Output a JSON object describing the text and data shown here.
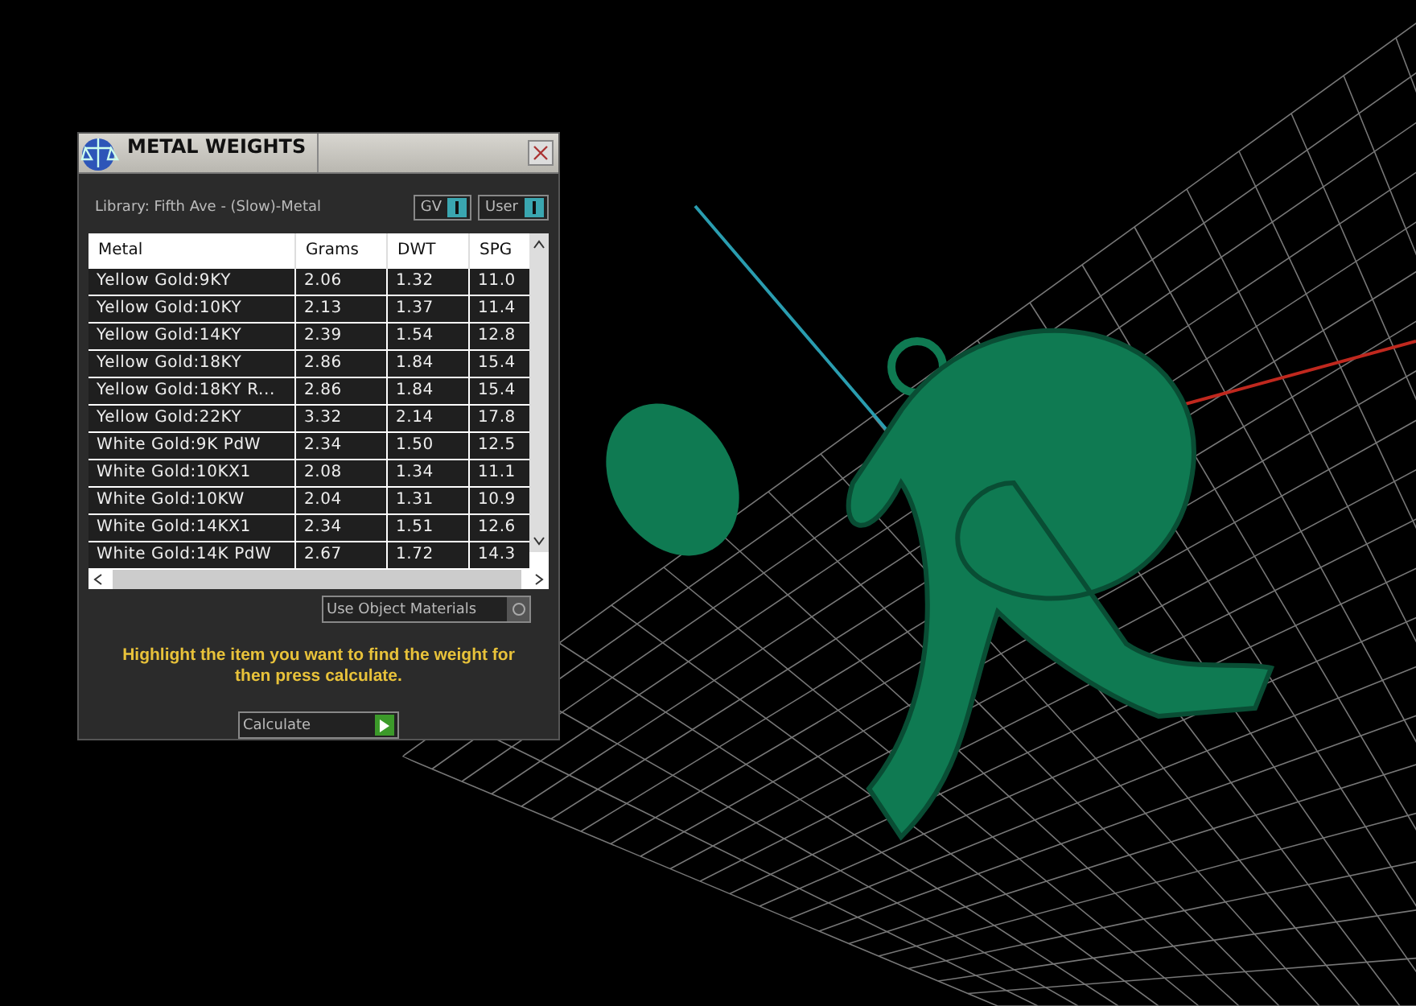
{
  "panel": {
    "title": "METAL WEIGHTS",
    "library": "Library: Fifth Ave - (Slow)-Metal",
    "toggles": [
      {
        "label": "GV",
        "on": true
      },
      {
        "label": "User",
        "on": true
      }
    ],
    "table": {
      "columns": [
        "Metal",
        "Grams",
        "DWT",
        "SPG"
      ],
      "rows": [
        {
          "metal": "Yellow Gold:9KY",
          "grams": "2.06",
          "dwt": "1.32",
          "spg": "11.0"
        },
        {
          "metal": "Yellow Gold:10KY",
          "grams": "2.13",
          "dwt": "1.37",
          "spg": "11.4"
        },
        {
          "metal": "Yellow Gold:14KY",
          "grams": "2.39",
          "dwt": "1.54",
          "spg": "12.8"
        },
        {
          "metal": "Yellow Gold:18KY",
          "grams": "2.86",
          "dwt": "1.84",
          "spg": "15.4"
        },
        {
          "metal": "Yellow Gold:18KY R...",
          "grams": "2.86",
          "dwt": "1.84",
          "spg": "15.4"
        },
        {
          "metal": "Yellow Gold:22KY",
          "grams": "3.32",
          "dwt": "2.14",
          "spg": "17.8"
        },
        {
          "metal": "White Gold:9K PdW",
          "grams": "2.34",
          "dwt": "1.50",
          "spg": "12.5"
        },
        {
          "metal": "White Gold:10KX1",
          "grams": "2.08",
          "dwt": "1.34",
          "spg": "11.1"
        },
        {
          "metal": "White Gold:10KW",
          "grams": "2.04",
          "dwt": "1.31",
          "spg": "10.9"
        },
        {
          "metal": "White Gold:14KX1",
          "grams": "2.34",
          "dwt": "1.51",
          "spg": "12.6"
        },
        {
          "metal": "White Gold:14K PdW",
          "grams": "2.67",
          "dwt": "1.72",
          "spg": "14.3"
        }
      ]
    },
    "use_object_materials": {
      "label": "Use Object Materials",
      "checked": false
    },
    "hint": "Highlight the item you want to find the weight for then press calculate.",
    "calculate_button": "Calculate"
  }
}
